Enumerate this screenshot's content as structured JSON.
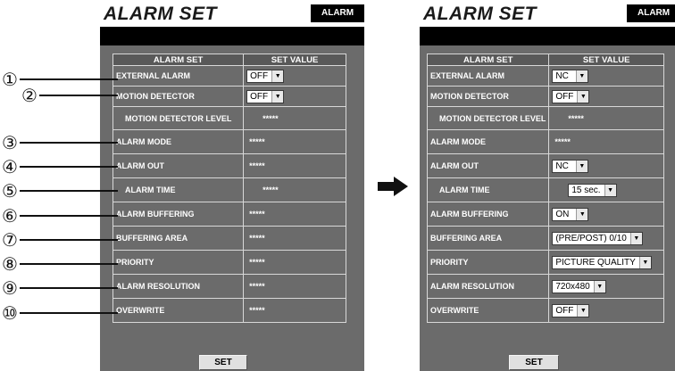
{
  "left_panel": {
    "title": "ALARM SET",
    "tab_label": "ALARM",
    "header": {
      "col1": "ALARM SET",
      "col2": "SET VALUE"
    },
    "rows": [
      {
        "label": "EXTERNAL ALARM",
        "value": "OFF",
        "kind": "dropdown"
      },
      {
        "label": "MOTION DETECTOR",
        "value": "OFF",
        "kind": "dropdown"
      },
      {
        "label": "MOTION DETECTOR LEVEL",
        "value": "*****",
        "kind": "text"
      },
      {
        "label": "ALARM MODE",
        "value": "*****",
        "kind": "text"
      },
      {
        "label": "ALARM OUT",
        "value": "*****",
        "kind": "text"
      },
      {
        "label": "ALARM TIME",
        "value": "*****",
        "kind": "text"
      },
      {
        "label": "ALARM BUFFERING",
        "value": "*****",
        "kind": "text"
      },
      {
        "label": "BUFFERING AREA",
        "value": "*****",
        "kind": "text"
      },
      {
        "label": "PRIORITY",
        "value": "*****",
        "kind": "text"
      },
      {
        "label": "ALARM RESOLUTION",
        "value": "*****",
        "kind": "text"
      },
      {
        "label": "OVERWRITE",
        "value": "*****",
        "kind": "text"
      }
    ],
    "set_button": "SET"
  },
  "right_panel": {
    "title": "ALARM SET",
    "tab_label": "ALARM",
    "header": {
      "col1": "ALARM SET",
      "col2": "SET VALUE"
    },
    "rows": [
      {
        "label": "EXTERNAL ALARM",
        "value": "NC",
        "kind": "dropdown"
      },
      {
        "label": "MOTION DETECTOR",
        "value": "OFF",
        "kind": "dropdown"
      },
      {
        "label": "MOTION DETECTOR LEVEL",
        "value": "*****",
        "kind": "text"
      },
      {
        "label": "ALARM MODE",
        "value": "*****",
        "kind": "text"
      },
      {
        "label": "ALARM OUT",
        "value": "NC",
        "kind": "dropdown"
      },
      {
        "label": "ALARM TIME",
        "value": "15 sec.",
        "kind": "dropdown"
      },
      {
        "label": "ALARM BUFFERING",
        "value": "ON",
        "kind": "dropdown"
      },
      {
        "label": "BUFFERING AREA",
        "value": "(PRE/POST) 0/10",
        "kind": "dropdown"
      },
      {
        "label": "PRIORITY",
        "value": "PICTURE QUALITY",
        "kind": "dropdown"
      },
      {
        "label": "ALARM RESOLUTION",
        "value": "720x480",
        "kind": "dropdown"
      },
      {
        "label": "OVERWRITE",
        "value": "OFF",
        "kind": "dropdown"
      }
    ],
    "set_button": "SET"
  },
  "callouts": [
    "①",
    "②",
    "③",
    "④",
    "⑤",
    "⑥",
    "⑦",
    "⑧",
    "⑨",
    "⑩"
  ],
  "icons": {
    "transition_arrow": "right-arrow-icon"
  },
  "colors": {
    "panel_bg": "#6b6b6b",
    "titlebar_bg": "#ffffff",
    "bar_bg": "#000000",
    "border": "#d8d8d8"
  }
}
